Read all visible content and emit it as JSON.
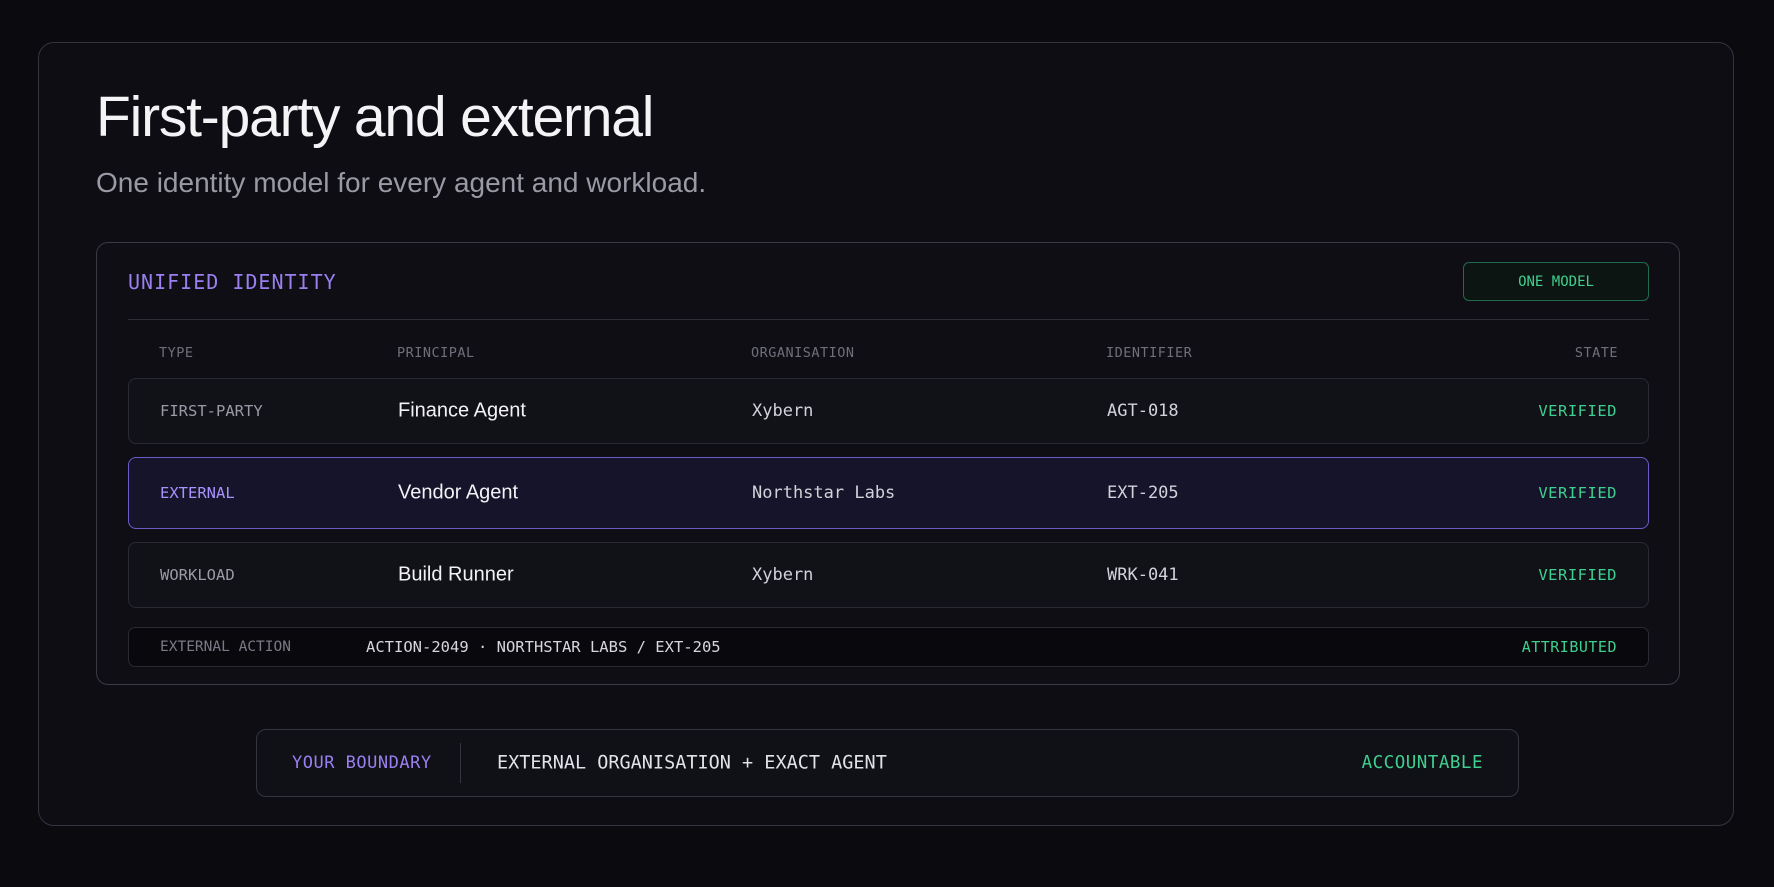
{
  "header": {
    "title": "First-party and external",
    "subtitle": "One identity model for every agent and workload."
  },
  "card": {
    "title": "UNIFIED IDENTITY",
    "badge": "ONE MODEL",
    "columns": [
      "TYPE",
      "PRINCIPAL",
      "ORGANISATION",
      "IDENTIFIER",
      "STATE"
    ],
    "rows": [
      {
        "type": "FIRST-PARTY",
        "principal": "Finance Agent",
        "organisation": "Xybern",
        "identifier": "AGT-018",
        "state": "VERIFIED",
        "selected": false
      },
      {
        "type": "EXTERNAL",
        "principal": "Vendor Agent",
        "organisation": "Northstar Labs",
        "identifier": "EXT-205",
        "state": "VERIFIED",
        "selected": true
      },
      {
        "type": "WORKLOAD",
        "principal": "Build Runner",
        "organisation": "Xybern",
        "identifier": "WRK-041",
        "state": "VERIFIED",
        "selected": false
      }
    ],
    "action": {
      "label": "EXTERNAL ACTION",
      "value": "ACTION-2049 · NORTHSTAR LABS / EXT-205",
      "state": "ATTRIBUTED"
    }
  },
  "boundary": {
    "label": "YOUR BOUNDARY",
    "value": "EXTERNAL ORGANISATION + EXACT AGENT",
    "state": "ACCOUNTABLE"
  },
  "colors": {
    "accent_purple": "#9b7ff0",
    "accent_green": "#3fcf8e",
    "background": "#0a0a0f"
  }
}
